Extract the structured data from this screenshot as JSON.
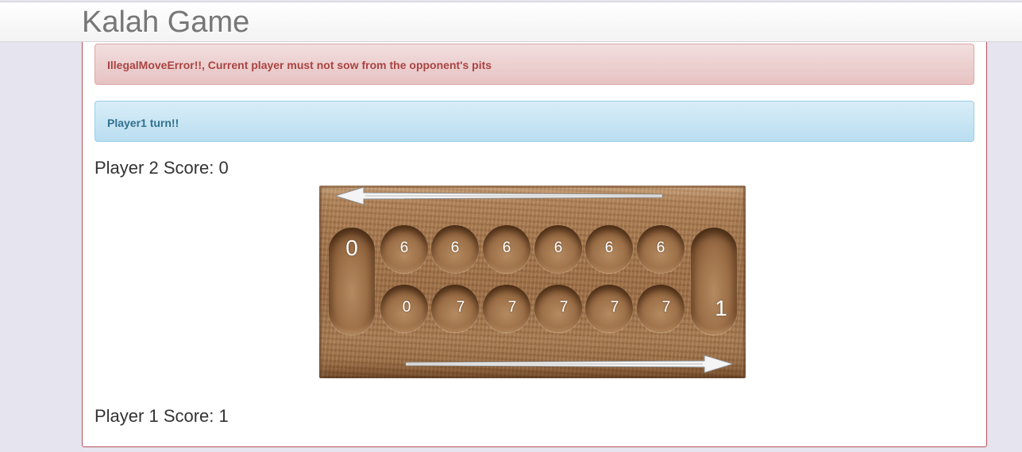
{
  "header": {
    "title": "Kalah Game"
  },
  "alerts": {
    "error": "IllegalMoveError!!, Current player must not sow from the opponent's pits",
    "info": "Player1 turn!!"
  },
  "scores": {
    "player2_label": "Player 2 Score: 0",
    "player1_label": "Player 1 Score: 1"
  },
  "board": {
    "player2_store": "0",
    "player2_pits": [
      "6",
      "6",
      "6",
      "6",
      "6",
      "6"
    ],
    "player1_pits": [
      "0",
      "7",
      "7",
      "7",
      "7",
      "7"
    ],
    "player1_store": "1"
  },
  "colors": {
    "error_text": "#a94442",
    "info_text": "#31708f",
    "panel_border": "#b9535a"
  }
}
